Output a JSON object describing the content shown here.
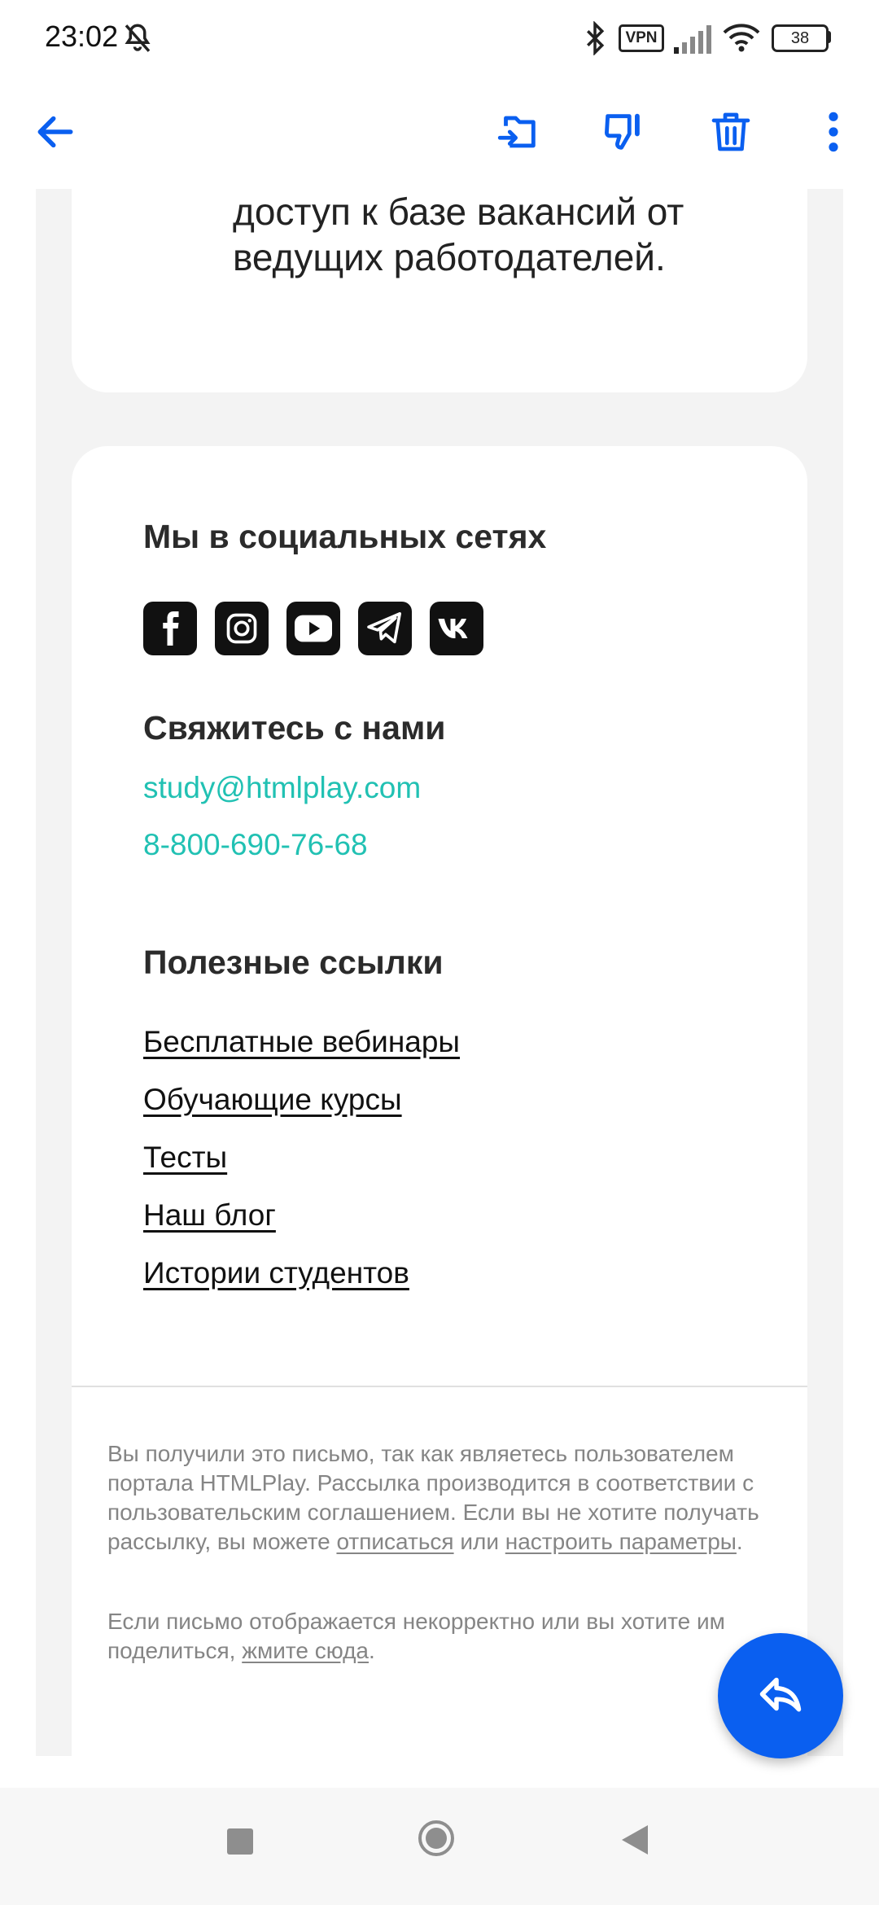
{
  "status_bar": {
    "time": "23:02",
    "vpn": "VPN",
    "battery": "38"
  },
  "toolbar": {
    "icons": [
      "back-arrow-icon",
      "move-to-folder-icon",
      "spam-icon",
      "trash-icon",
      "more-vertical-icon"
    ]
  },
  "email": {
    "intro_tail": "доступ к базе вакансий от ведущих работодателей.",
    "social": {
      "heading": "Мы в социальных сетях",
      "networks": [
        "facebook",
        "instagram",
        "youtube",
        "telegram",
        "vk"
      ]
    },
    "contact": {
      "heading": "Свяжитесь с нами",
      "email": "study@htmlplay.com",
      "phone": "8-800-690-76-68"
    },
    "links": {
      "heading": "Полезные ссылки",
      "items": [
        "Бесплатные вебинары",
        "Обучающие курсы",
        "Тесты",
        "Наш блог",
        "Истории студентов"
      ]
    },
    "footer": {
      "p1_text": "Вы получили это письмо, так как являетесь пользователем портала HTMLPlay. Рассылка производится в соответствии с пользовательским соглашением. Если вы не хотите получать рассылку, вы можете ",
      "p1_link1": "отписаться",
      "p1_mid": " или ",
      "p1_link2": "настроить параметры",
      "p1_end": ".",
      "p2_text": "Если письмо отображается некорректно или вы хотите им поделиться, ",
      "p2_link": "жмите сюда",
      "p2_end": "."
    }
  },
  "colors": {
    "accent": "#0a5ff0",
    "link_teal": "#21c1b3",
    "text": "#2b2b2b",
    "muted": "#858585"
  }
}
